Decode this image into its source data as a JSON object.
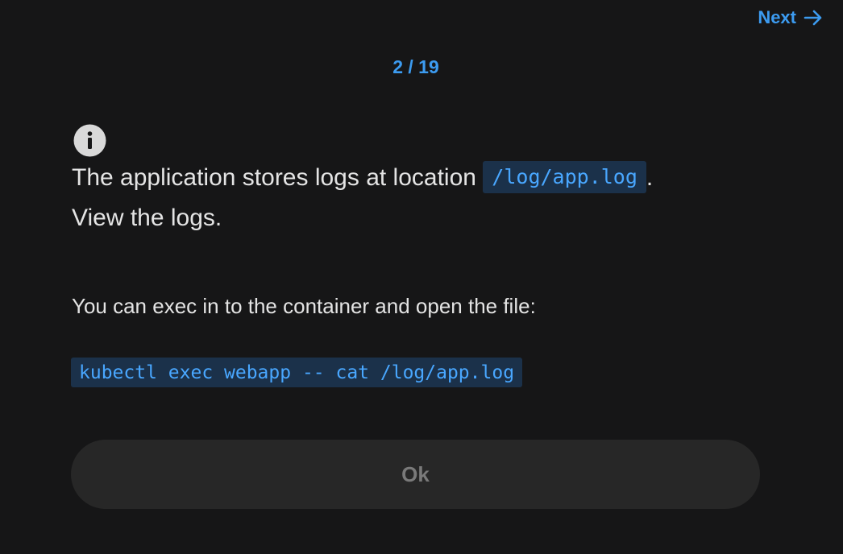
{
  "header": {
    "next_label": "Next",
    "next_icon": "arrow-right-icon",
    "counter": "2 / 19"
  },
  "question": {
    "icon": "info-icon",
    "text_before": "The application stores logs at location ",
    "inline_code": "/log/app.log",
    "text_after": ".",
    "line2": "View the logs."
  },
  "hint": {
    "text": "You can exec in to the container and open the file:",
    "command": "kubectl exec webapp -- cat /log/app.log"
  },
  "actions": {
    "ok_label": "Ok"
  },
  "colors": {
    "background": "#161617",
    "accent": "#3c9bf0",
    "code_background": "#1b314a",
    "button_background": "#272727"
  }
}
